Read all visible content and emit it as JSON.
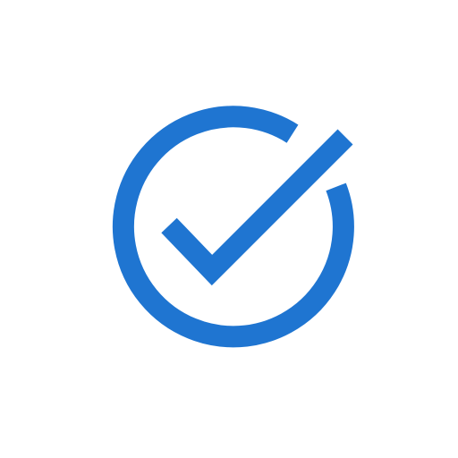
{
  "icon": {
    "name": "check-circle-icon",
    "color": "#1f75d1",
    "background": "#ffffff"
  }
}
